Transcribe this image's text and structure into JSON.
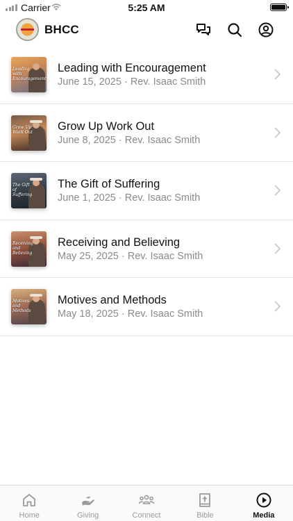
{
  "status_bar": {
    "carrier": "Carrier",
    "time": "5:25 AM"
  },
  "header": {
    "title": "BHCC",
    "icons": [
      "chat-icon",
      "search-icon",
      "account-icon"
    ]
  },
  "sermons": [
    {
      "title": "Leading with Encouragement",
      "date": "June 15, 2025",
      "speaker": "Rev. Isaac Smith",
      "thumb_text": "Leading with Encouragement"
    },
    {
      "title": "Grow Up Work Out",
      "date": "June 8, 2025",
      "speaker": "Rev. Isaac Smith",
      "thumb_text": "Grow Up Work Out"
    },
    {
      "title": "The Gift of Suffering",
      "date": "June 1, 2025",
      "speaker": "Rev. Isaac Smith",
      "thumb_text": "The Gift of Suffering"
    },
    {
      "title": "Receiving and Believing",
      "date": "May 25, 2025",
      "speaker": "Rev. Isaac Smith",
      "thumb_text": "Receiving and Believing"
    },
    {
      "title": "Motives and Methods",
      "date": "May 18, 2025",
      "speaker": "Rev. Isaac Smith",
      "thumb_text": "Motives and Methods"
    }
  ],
  "meta_separator": " · ",
  "tabs": [
    {
      "label": "Home",
      "icon": "home-icon",
      "active": false
    },
    {
      "label": "Giving",
      "icon": "giving-hand-icon",
      "active": false
    },
    {
      "label": "Connect",
      "icon": "people-icon",
      "active": false
    },
    {
      "label": "Bible",
      "icon": "bible-icon",
      "active": false
    },
    {
      "label": "Media",
      "icon": "play-circle-icon",
      "active": true
    }
  ],
  "colors": {
    "active_tab": "#111111",
    "inactive_tab": "#9a9a9a",
    "meta_text": "#8a8a8a",
    "divider": "#e6e6e6"
  }
}
